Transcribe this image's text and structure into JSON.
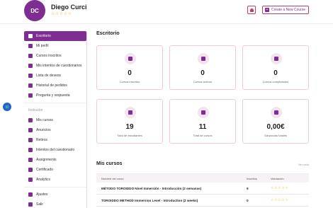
{
  "header": {
    "avatar_initials": "DC",
    "user_name": "Diego Curci",
    "user_stars": "☆☆☆☆☆",
    "create_course_label": "Create a New Course"
  },
  "sidebar": {
    "items_top": [
      {
        "label": "Escritorio",
        "icon": "palette-icon",
        "active": true
      },
      {
        "label": "Mi perfil",
        "icon": "user-icon"
      },
      {
        "label": "Cursos inscritos",
        "icon": "graduation-cap-icon"
      },
      {
        "label": "Mis intentos de cuestionarios",
        "icon": "puzzle-icon"
      },
      {
        "label": "Lista de deseos",
        "icon": "bookmark-icon"
      },
      {
        "label": "Historial de pedidos",
        "icon": "cart-icon"
      },
      {
        "label": "Pregunta y respuesta",
        "icon": "question-icon"
      }
    ],
    "section_label": "Instructor",
    "items_instructor": [
      {
        "label": "Mis cursos",
        "icon": "rocket-icon"
      },
      {
        "label": "Anuncios",
        "icon": "megaphone-icon"
      },
      {
        "label": "Retiros",
        "icon": "wallet-icon"
      },
      {
        "label": "Intentos del cuestionario",
        "icon": "puzzle-icon"
      },
      {
        "label": "Assignments",
        "icon": "clipboard-icon"
      },
      {
        "label": "Certificado",
        "icon": "certificate-icon"
      },
      {
        "label": "Analytics",
        "icon": "chart-icon"
      }
    ],
    "items_bottom": [
      {
        "label": "Ajustes",
        "icon": "gear-icon"
      },
      {
        "label": "Salir",
        "icon": "logout-icon"
      }
    ]
  },
  "dashboard": {
    "title": "Escritorio",
    "stats": [
      {
        "value": "0",
        "label": "Cursos inscritos",
        "icon": "book-icon"
      },
      {
        "value": "0",
        "label": "Cursos activos",
        "icon": "graduation-cap-icon"
      },
      {
        "value": "0",
        "label": "Cursos completados",
        "icon": "trophy-icon"
      },
      {
        "value": "19",
        "label": "Total de estudiantes",
        "icon": "student-icon"
      },
      {
        "value": "11",
        "label": "Total de cursos",
        "icon": "folder-icon"
      },
      {
        "value": "0,00€",
        "label": "Ganancias totales",
        "icon": "money-icon"
      }
    ]
  },
  "courses": {
    "title": "Mis cursos",
    "see_all": "Ver todo",
    "columns": [
      "Nombre del curso",
      "Inscritos",
      "Valoración"
    ],
    "rows": [
      {
        "name": "MÉTODO TOROIDDO Nivel Inmersión - Introducción (2 semanas)",
        "enrolled": "9",
        "rating": "☆☆☆☆☆"
      },
      {
        "name": "TOROIDDO METHOD Immersion Level - Introduction (2 weeks)",
        "enrolled": "0",
        "rating": "☆☆☆☆☆"
      }
    ]
  }
}
